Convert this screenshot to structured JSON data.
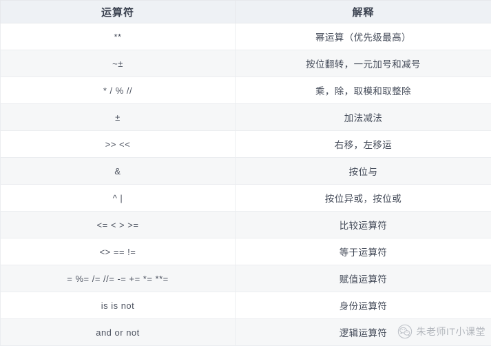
{
  "table": {
    "headers": [
      "运算符",
      "解释"
    ],
    "rows": [
      {
        "operator": "**",
        "description": "幂运算（优先级最高）"
      },
      {
        "operator": "~±",
        "description": "按位翻转，一元加号和减号"
      },
      {
        "operator": "* / % //",
        "description": "乘，除，取模和取整除"
      },
      {
        "operator": "±",
        "description": "加法减法"
      },
      {
        "operator": ">> <<",
        "description": "右移，左移运"
      },
      {
        "operator": "&",
        "description": "按位与"
      },
      {
        "operator": "^ |",
        "description": "按位异或，按位或"
      },
      {
        "operator": "<= < > >=",
        "description": "比较运算符"
      },
      {
        "operator": "<> == !=",
        "description": "等于运算符"
      },
      {
        "operator": "= %= /= //= -= += *= **=",
        "description": "赋值运算符"
      },
      {
        "operator": "is is not",
        "description": "身份运算符"
      },
      {
        "operator": "and or not",
        "description": "逻辑运算符"
      }
    ]
  },
  "watermark": {
    "icon": "wechat-icon",
    "text": "朱老师IT小课堂"
  },
  "colors": {
    "header_bg": "#eef1f5",
    "row_odd_bg": "#ffffff",
    "row_even_bg": "#f6f7f8",
    "border": "#ebedf0",
    "text": "#4a5160",
    "watermark_text": "#8a8f99"
  }
}
